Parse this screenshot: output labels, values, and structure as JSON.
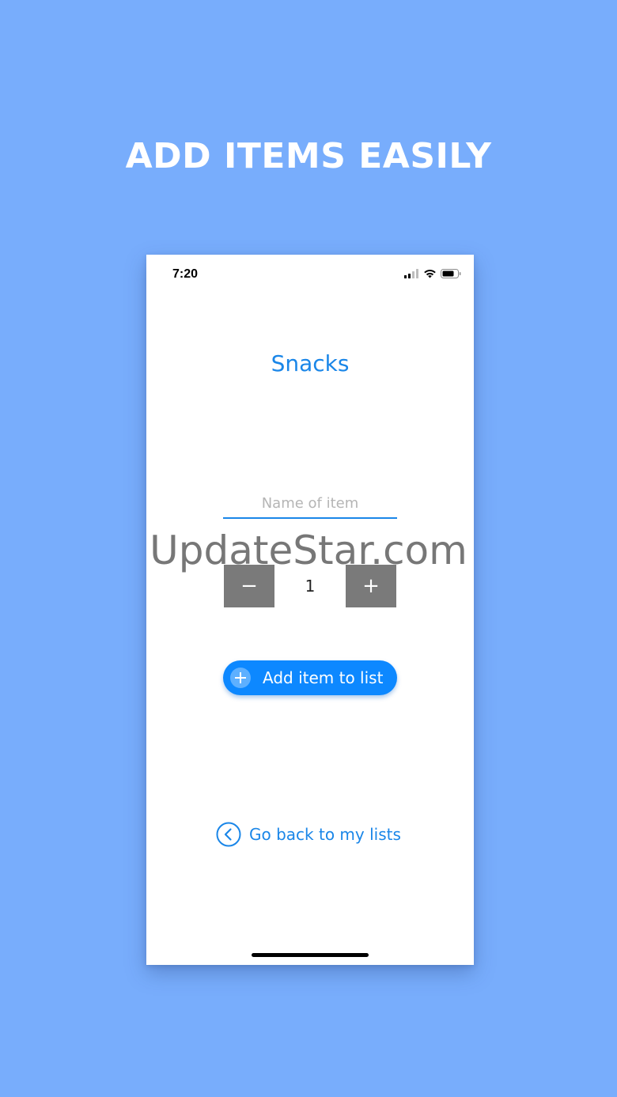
{
  "promo": {
    "headline": "ADD ITEMS EASILY"
  },
  "status_bar": {
    "time": "7:20",
    "icons": [
      "signal-icon",
      "wifi-icon",
      "battery-icon"
    ]
  },
  "list": {
    "title": "Snacks"
  },
  "item_form": {
    "name_placeholder": "Name of item",
    "name_value": "",
    "quantity": "1",
    "decrement_label": "−",
    "increment_label": "+",
    "add_button_label": "Add item to list",
    "add_button_icon": "plus-circle-icon"
  },
  "navigation": {
    "back_label": "Go back to my lists",
    "back_icon": "chevron-left-circle-icon"
  },
  "watermark": "UpdateStar.com",
  "colors": {
    "background": "#78adfc",
    "accent": "#1a86e8",
    "button_blue": "#0d88ff",
    "stepper_gray": "#7a7a7a"
  }
}
